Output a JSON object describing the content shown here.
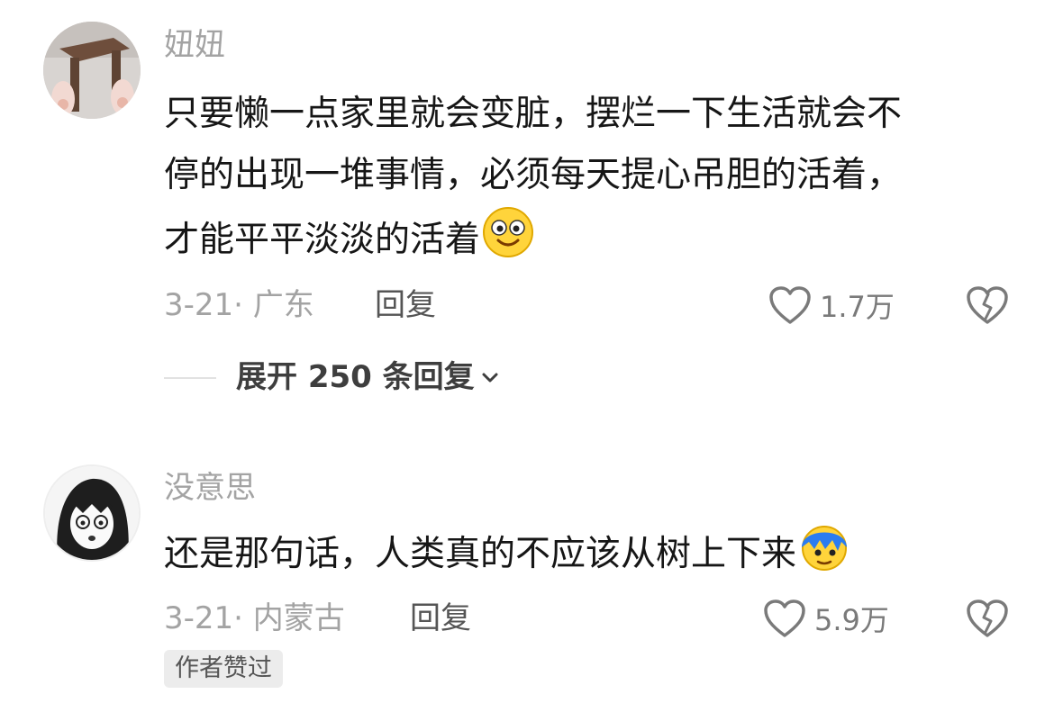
{
  "comments": [
    {
      "username": "妞妞",
      "content_lines": [
        "只要懒一点家里就会变脏，摆烂一下生活就会不",
        "停的出现一堆事情，必须每天提心吊胆的活着，",
        "才能平平淡淡的活着"
      ],
      "content_emoji": "smiling-face-emoji",
      "date": "3-21",
      "location": "广东",
      "reply_label": "回复",
      "like_count": "1.7万",
      "expand_label": "展开 250 条回复"
    },
    {
      "username": "没意思",
      "content_lines": [
        "还是那句话，人类真的不应该从树上下来"
      ],
      "content_emoji": "blue-hair-character-emoji",
      "date": "3-21",
      "location": "内蒙古",
      "reply_label": "回复",
      "like_count": "5.9万",
      "badge": "作者赞过"
    }
  ],
  "colors": {
    "username": "#a3a3a3",
    "content": "#161616",
    "meta": "#a3a3a3",
    "action": "#7a7a7a",
    "badge_bg": "#ececec"
  }
}
